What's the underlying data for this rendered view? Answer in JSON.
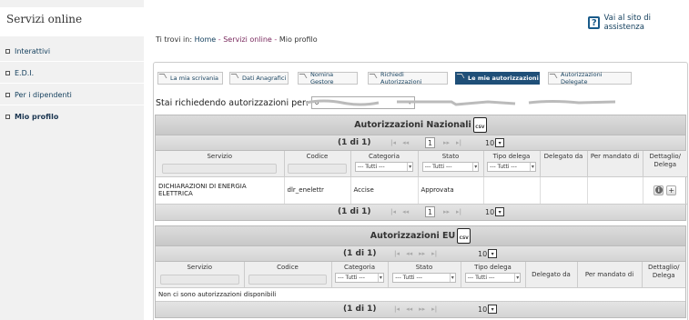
{
  "sidebar": {
    "title": "Servizi online",
    "items": [
      {
        "label": "Interattivi"
      },
      {
        "label": "E.D.I."
      },
      {
        "label": "Per i dipendenti"
      },
      {
        "label": "Mio profilo"
      }
    ]
  },
  "header": {
    "assist_icon": "question-icon",
    "assist_link": "Vai al sito di assistenza"
  },
  "breadcrumb": {
    "prefix": "Ti trovi in:",
    "home": "Home",
    "sep": " - ",
    "services": "Servizi online",
    "current": "Mio profilo"
  },
  "tabs": [
    {
      "label": "La mia scrivania"
    },
    {
      "label": "Dati Anagrafici"
    },
    {
      "label": "Nomina Gestore"
    },
    {
      "label": "Richiedi Autorizzazioni"
    },
    {
      "label": "Le mie autorizzazioni"
    },
    {
      "label": "Autorizzazioni Delegate"
    }
  ],
  "request": {
    "label": "Stai richiedendo autorizzazioni per:",
    "value": "0"
  },
  "national": {
    "title": "Autorizzazioni Nazionali",
    "csv_label": "CSV",
    "pager_info": "(1 di 1)",
    "page": "1",
    "rows": "10",
    "columns": [
      "Servizio",
      "Codice",
      "Categoria",
      "Stato",
      "Tipo delega",
      "Delegato da",
      "Per mandato di",
      "Dettaglio/ Delega"
    ],
    "filter_all": "--- Tutti ---",
    "data": [
      {
        "servizio": "DICHIARAZIONI DI ENERGIA ELETTRICA",
        "codice": "dlr_enelettr",
        "categoria": "Accise",
        "stato": "Approvata",
        "tipo": "",
        "delegato": "",
        "mandato": ""
      }
    ]
  },
  "eu": {
    "title": "Autorizzazioni EU",
    "csv_label": "CSV",
    "pager_info": "(1 di 1)",
    "rows": "10",
    "columns": [
      "Servizio",
      "Codice",
      "Categoria",
      "Stato",
      "Tipo delega",
      "Delegato da",
      "Per mandato di",
      "Dettaglio/ Delega"
    ],
    "filter_all": "--- Tutti ---",
    "empty": "Non ci sono autorizzazioni disponibili"
  },
  "colors": {
    "accent": "#1f4f78",
    "link": "#123e5c"
  }
}
